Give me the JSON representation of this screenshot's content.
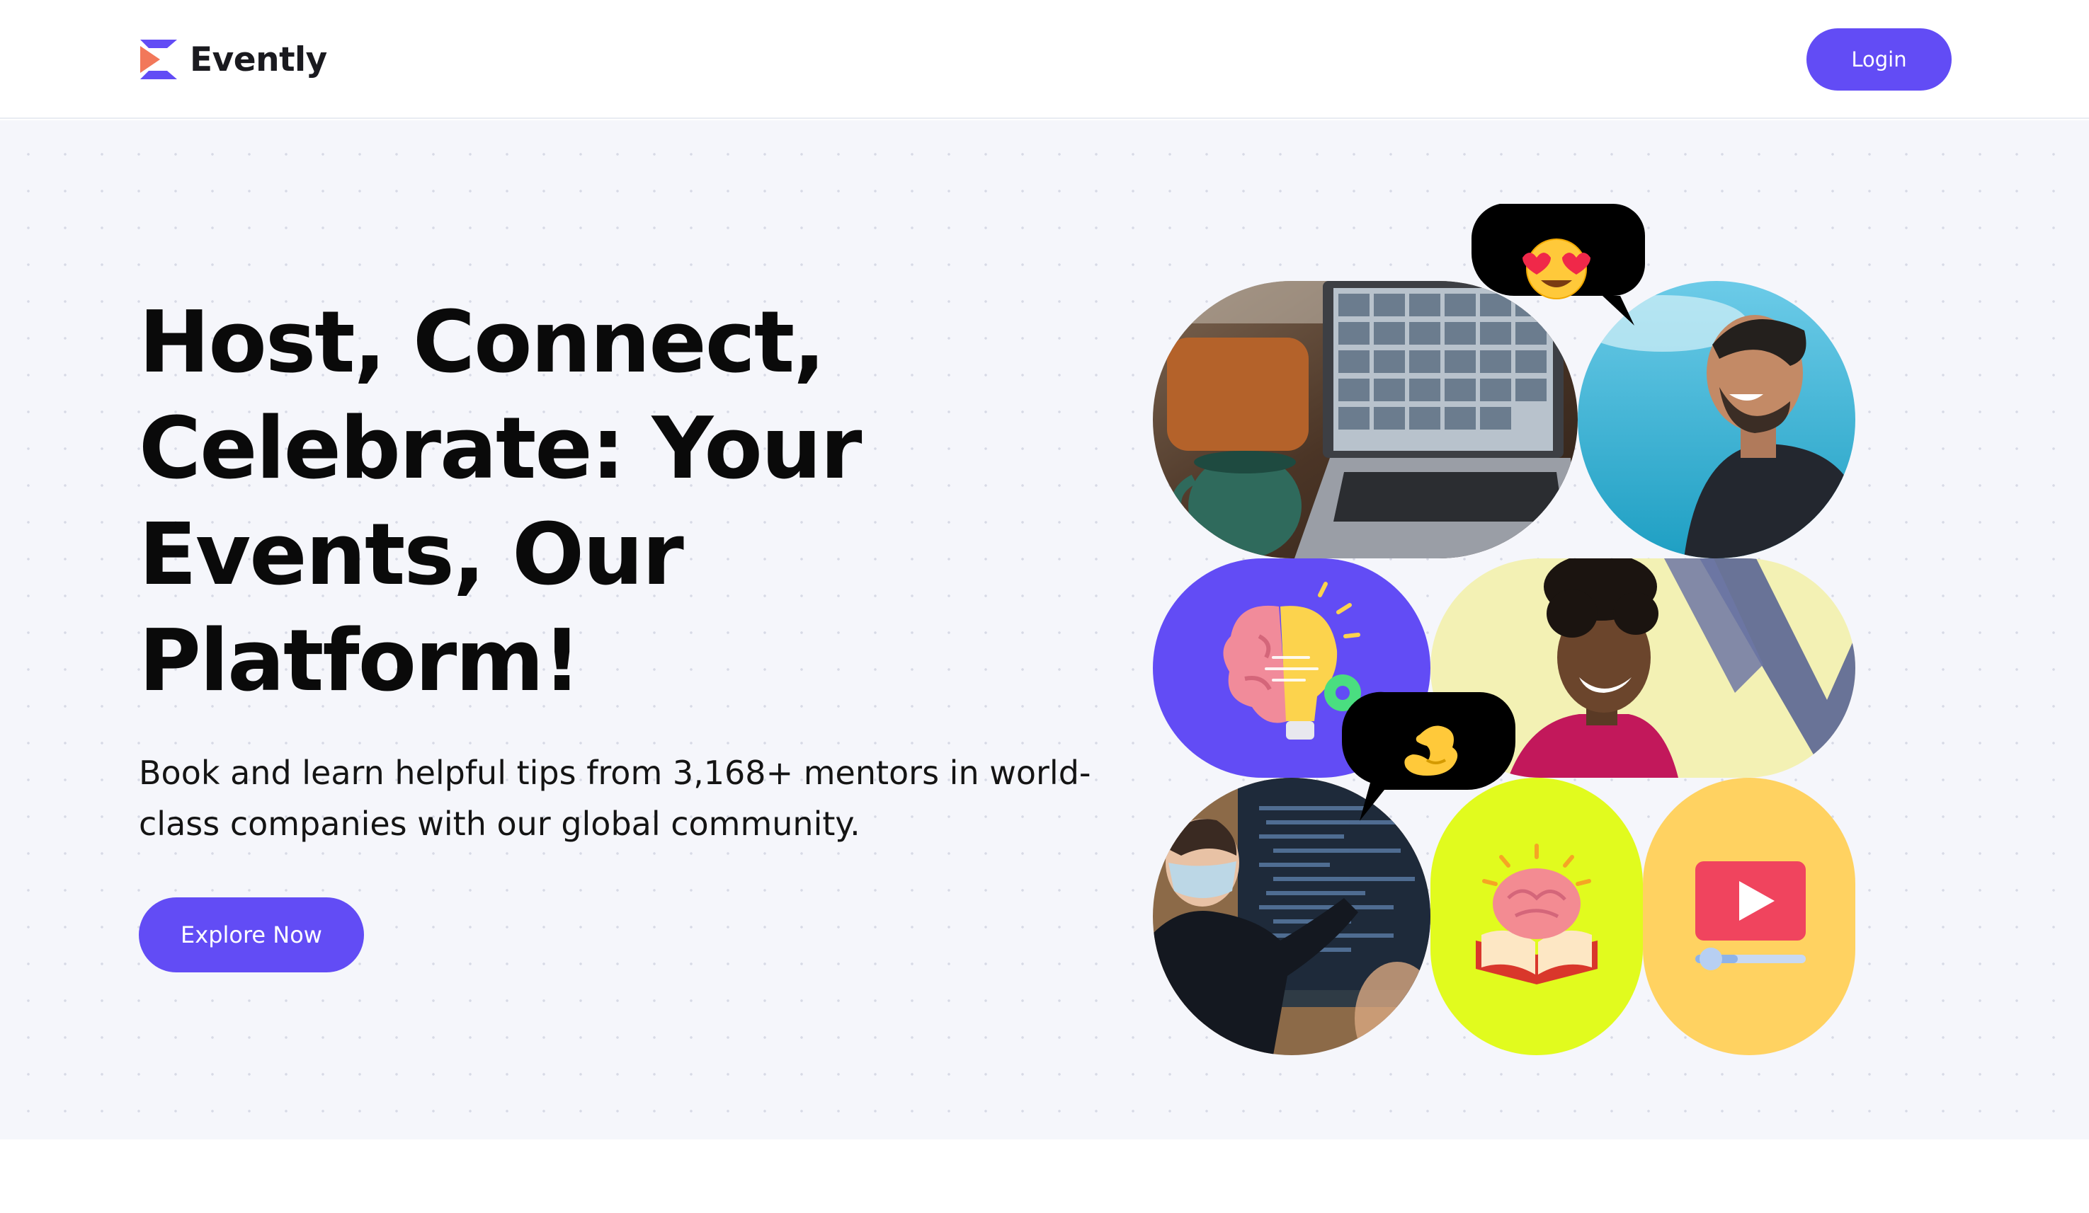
{
  "nav": {
    "brand_name": "Evently",
    "login_label": "Login"
  },
  "hero": {
    "headline": "Host, Connect, Celebrate: Your Events, Our Platform!",
    "subtext": "Book and learn helpful tips from 3,168+ mentors in world-class companies with our global community.",
    "cta_label": "Explore Now"
  },
  "collage": {
    "tiles": [
      {
        "name": "video-call-laptop-photo",
        "bg": "#5b4230"
      },
      {
        "name": "smiling-man-photo",
        "bg": "#3fb6d8"
      },
      {
        "name": "brain-bulb-illustration",
        "bg": "#624cf5"
      },
      {
        "name": "smiling-woman-photo",
        "bg": "#f3f1b4"
      },
      {
        "name": "presenter-photo",
        "bg": "#23282e"
      },
      {
        "name": "brain-book-illustration",
        "bg": "#e1fb1e"
      },
      {
        "name": "video-player-illustration",
        "bg": "#ffd261"
      }
    ],
    "bubbles": [
      {
        "name": "heart-eyes-emoji-bubble",
        "icon": "heart-eyes-emoji-icon"
      },
      {
        "name": "pinching-hand-emoji-bubble",
        "icon": "pinching-hand-emoji-icon"
      }
    ]
  },
  "colors": {
    "accent": "#624cf5",
    "hero_bg": "#f5f6fb",
    "logo_orange": "#f2785a",
    "logo_purple": "#624cf5"
  }
}
